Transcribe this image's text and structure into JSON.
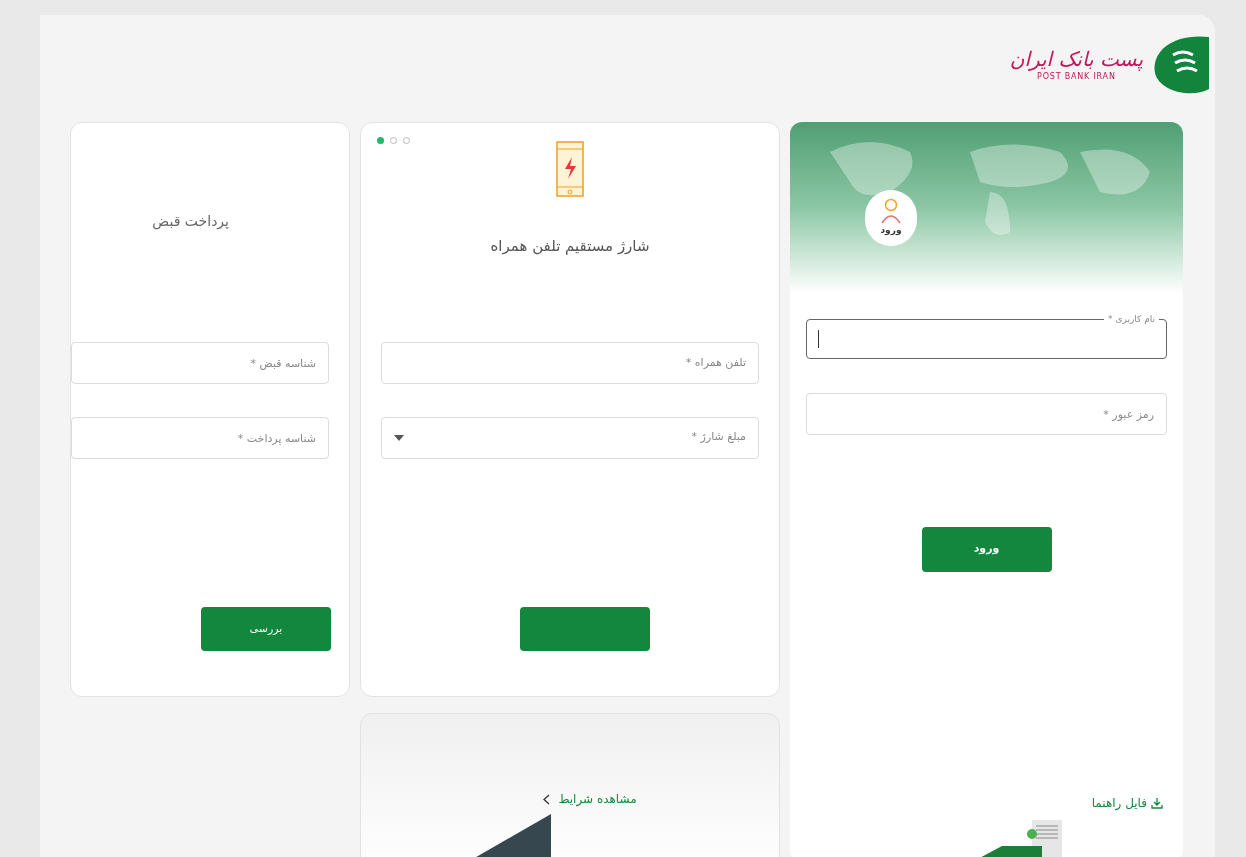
{
  "logo": {
    "name_fa": "پست بانک ایران",
    "name_en": "POST BANK IRAN"
  },
  "login_card": {
    "avatar_label": "ورود",
    "fields": [
      {
        "placeholder": "نام کاربری *",
        "focused": true
      },
      {
        "placeholder": "رمز عبور *",
        "focused": false
      }
    ],
    "submit_button": "ورود",
    "help_link": "فایل راهنما"
  },
  "charge_card": {
    "pager": [
      {
        "selected": true
      },
      {
        "selected": false
      },
      {
        "selected": false
      }
    ],
    "title": "شارژ مستقیم تلفن همراه",
    "fields": [
      {
        "placeholder": "تلفن همراه *",
        "kind": "text"
      },
      {
        "placeholder": "مبلغ شارژ *",
        "kind": "select"
      }
    ]
  },
  "bill_card": {
    "title": "پرداخت قبض",
    "fields": [
      {
        "placeholder": "شناسه قبض *",
        "kind": "text"
      },
      {
        "placeholder": "شناسه پرداخت *",
        "kind": "text"
      }
    ],
    "submit_button": "بررسی"
  },
  "terms_card": {
    "link": "مشاهده شرایط"
  }
}
